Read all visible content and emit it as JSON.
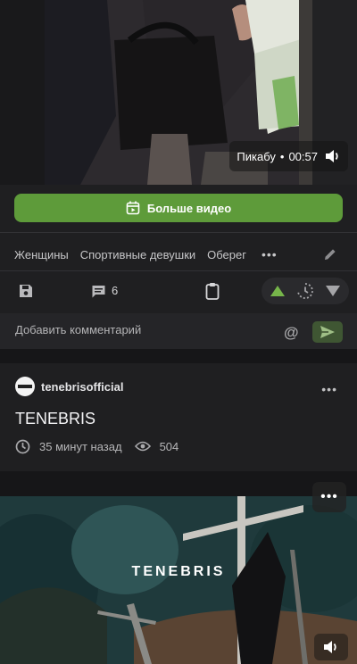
{
  "video1": {
    "source": "Пикабу",
    "separator": "•",
    "duration": "00:57"
  },
  "more_video_button": {
    "label": "Больше видео"
  },
  "tags": [
    "Женщины",
    "Спортивные девушки",
    "Оберег"
  ],
  "tags_more": "•••",
  "actions": {
    "comment_count": "6"
  },
  "comment_input": {
    "placeholder": "Добавить комментарий"
  },
  "post": {
    "author": "tenebrisofficial",
    "menu": "•••",
    "title": "TENEBRIS",
    "time": "35 минут назад",
    "views": "504"
  },
  "video2": {
    "overlay_title": "TENEBRIS",
    "menu": "•••"
  },
  "colors": {
    "accent": "#5e9b3a",
    "background": "#1f1f21",
    "vote_up": "#76b54a"
  }
}
